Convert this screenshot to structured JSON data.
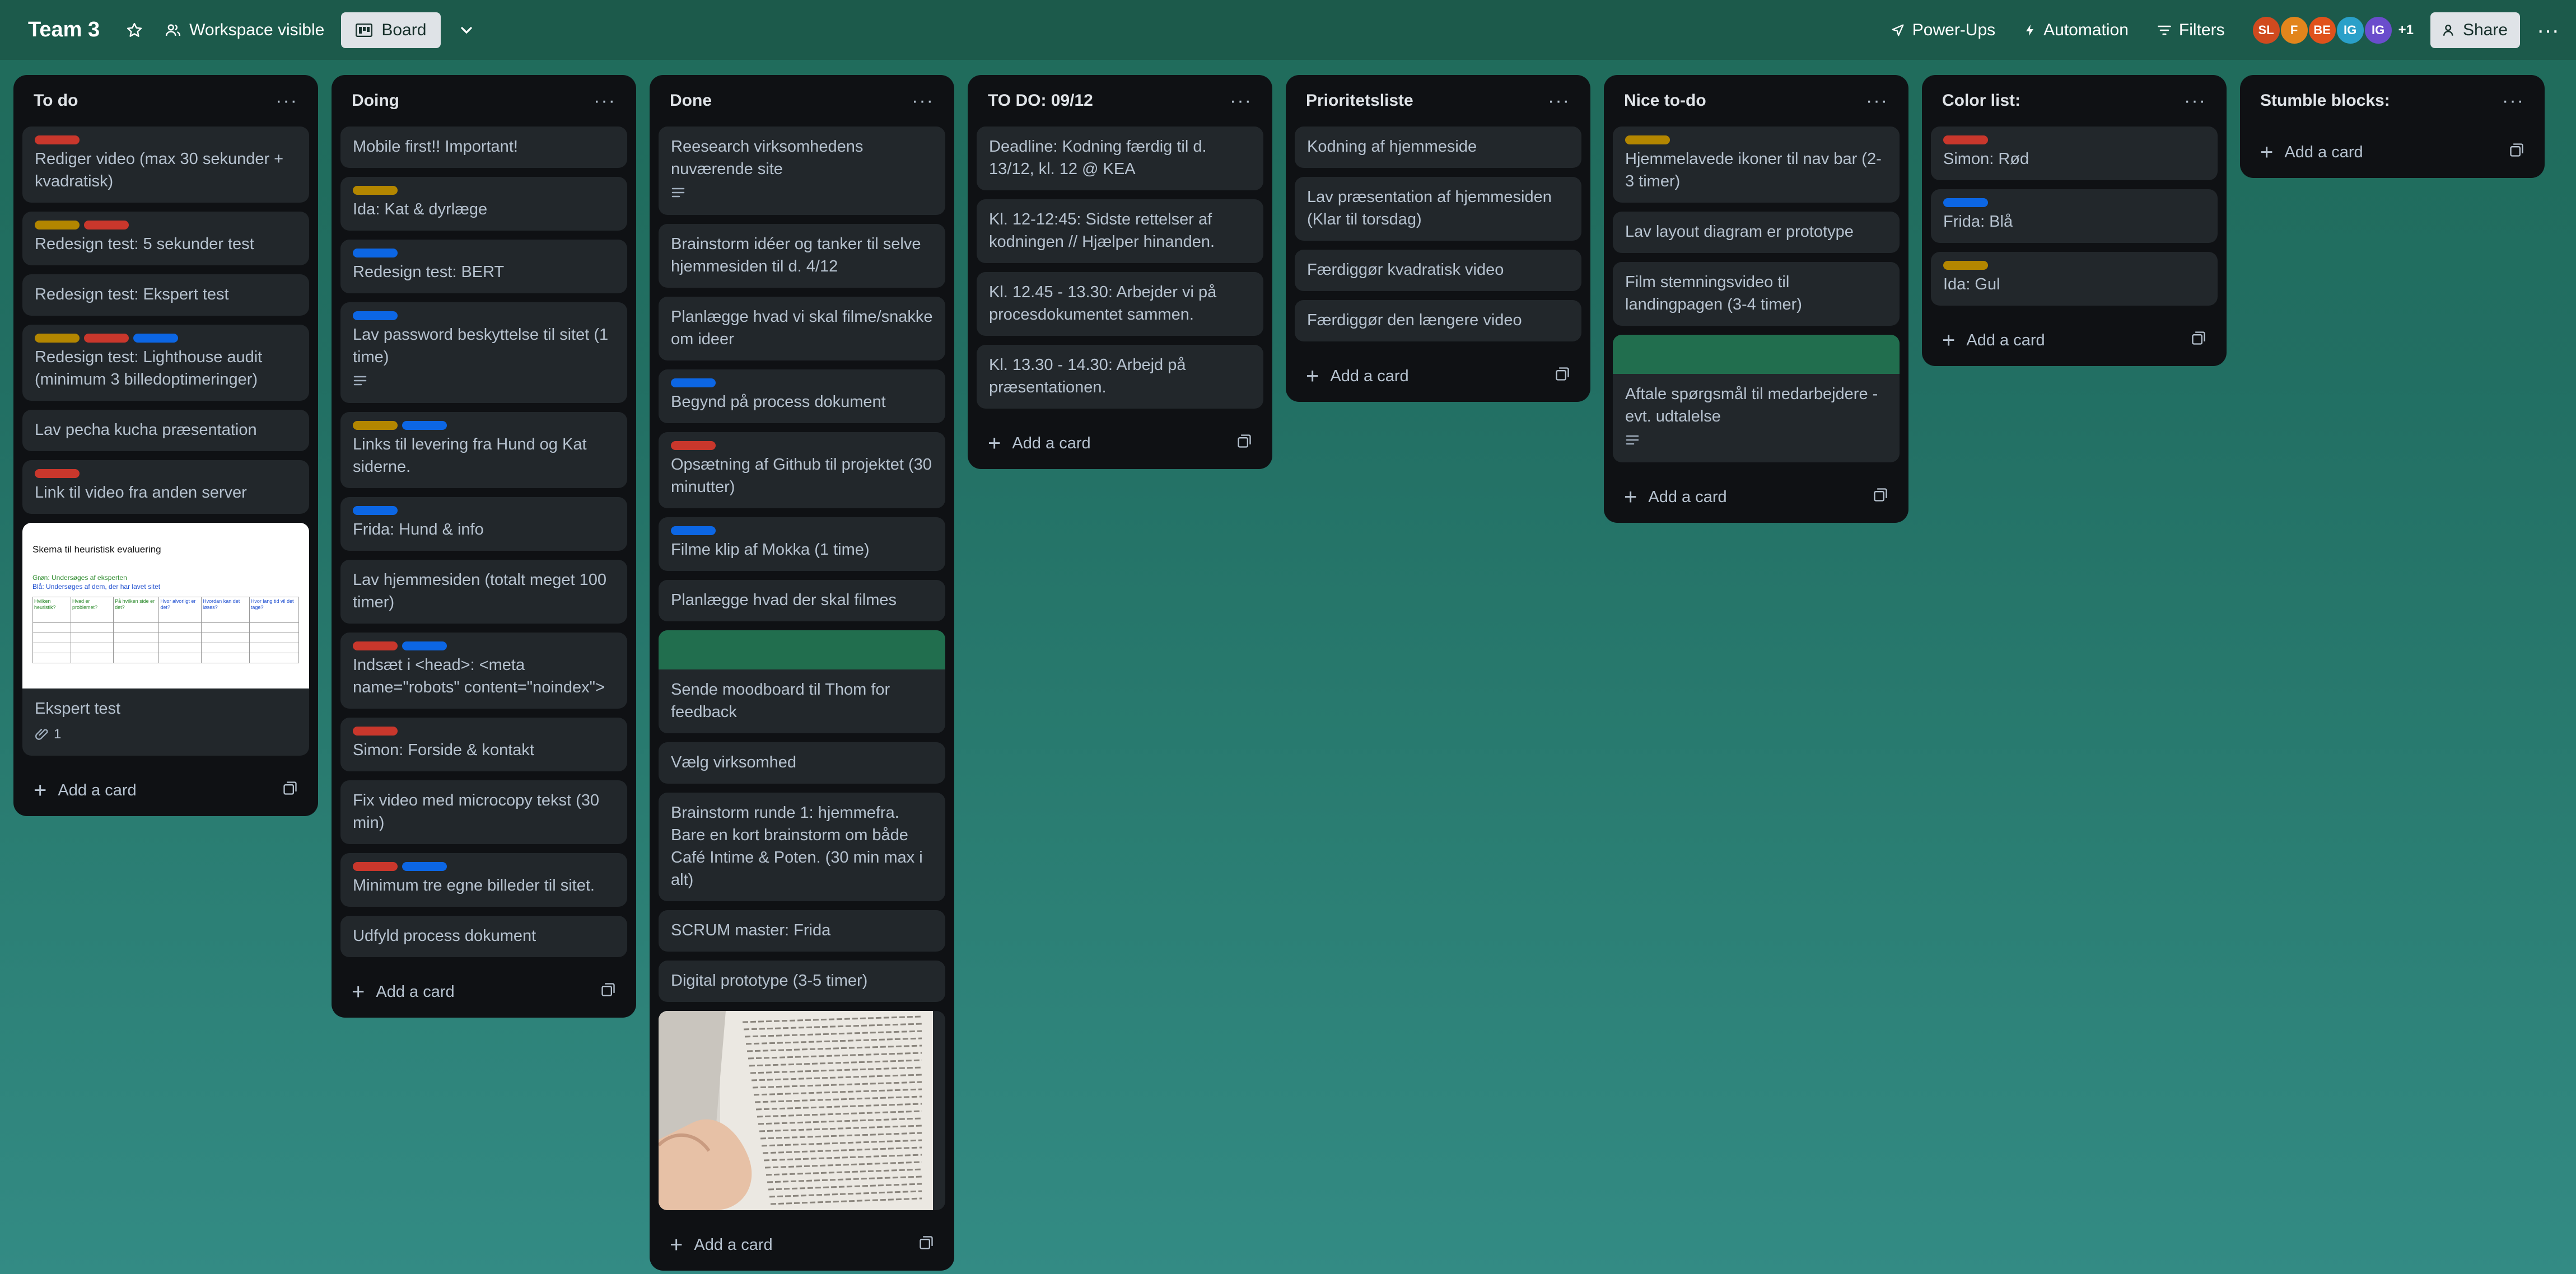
{
  "board": {
    "title": "Team 3",
    "visibility": "Workspace visible",
    "view": "Board"
  },
  "toolbar": {
    "powerups": "Power-Ups",
    "automation": "Automation",
    "filters": "Filters",
    "share": "Share",
    "more_members": "+1"
  },
  "members": [
    {
      "initials": "SL",
      "color": "#d04a1f"
    },
    {
      "initials": "F",
      "color": "#e2851c"
    },
    {
      "initials": "BE",
      "color": "#e0521c"
    },
    {
      "initials": "IG",
      "color": "#2aa0c9"
    },
    {
      "initials": "IG",
      "color": "#6a4dcc"
    }
  ],
  "add_card": "Add a card",
  "lists": [
    {
      "title": "To do",
      "cards": [
        {
          "text": "Rediger video (max 30 sekunder + kvadratisk)",
          "labels": [
            "red"
          ]
        },
        {
          "text": "Redesign test: 5 sekunder test",
          "labels": [
            "yellow",
            "red"
          ]
        },
        {
          "text": "Redesign test: Ekspert test",
          "labels": []
        },
        {
          "text": "Redesign test: Lighthouse audit (minimum 3 billedoptimeringer)",
          "labels": [
            "yellow",
            "red",
            "blue"
          ]
        },
        {
          "text": "Lav pecha kucha præsentation",
          "labels": []
        },
        {
          "text": "Link til video fra anden server",
          "labels": [
            "red"
          ]
        },
        {
          "text": "Ekspert test",
          "labels": [],
          "attachment": "1",
          "cover": "sheet",
          "sheet": {
            "title": "Skema til heuristisk evaluering",
            "line1": "Grøn: Undersøges af eksperten",
            "line2": "Blå: Undersøges af dem, der har lavet sitet",
            "cols": [
              "Hvilken heuristik?",
              "Hvad er problemet?",
              "På hvilken side er det?",
              "Hvor alvorligt er det?",
              "Hvordan kan det løses?",
              "Hvor lang tid vil det tage?"
            ]
          }
        }
      ]
    },
    {
      "title": "Doing",
      "cards": [
        {
          "text": "Mobile first!! Important!",
          "labels": []
        },
        {
          "text": "Ida: Kat & dyrlæge",
          "labels": [
            "yellow"
          ]
        },
        {
          "text": "Redesign test: BERT",
          "labels": [
            "blue"
          ]
        },
        {
          "text": "Lav password beskyttelse til sitet (1 time)",
          "labels": [
            "blue"
          ],
          "desc": true
        },
        {
          "text": "Links til levering fra Hund og Kat siderne.",
          "labels": [
            "yellow",
            "blue"
          ]
        },
        {
          "text": "Frida: Hund & info",
          "labels": [
            "blue"
          ]
        },
        {
          "text": "Lav hjemmesiden (totalt meget 100 timer)",
          "labels": []
        },
        {
          "text": "Indsæt i <head>: <meta name=\"robots\" content=\"noindex\">",
          "labels": [
            "red",
            "blue"
          ]
        },
        {
          "text": "Simon: Forside & kontakt",
          "labels": [
            "red"
          ]
        },
        {
          "text": "Fix video med microcopy tekst (30 min)",
          "labels": []
        },
        {
          "text": "Minimum tre egne billeder til sitet.",
          "labels": [
            "red",
            "blue"
          ]
        },
        {
          "text": "Udfyld process dokument",
          "labels": []
        }
      ]
    },
    {
      "title": "Done",
      "cards": [
        {
          "text": "Reesearch virksomhedens nuværende site",
          "labels": [],
          "desc": true
        },
        {
          "text": "Brainstorm idéer og tanker til selve hjemmesiden til d. 4/12",
          "labels": []
        },
        {
          "text": "Planlægge hvad vi skal filme/snakke om ideer",
          "labels": []
        },
        {
          "text": "Begynd på process dokument",
          "labels": [
            "blue"
          ]
        },
        {
          "text": "Opsætning af Github til projektet (30 minutter)",
          "labels": [
            "red"
          ]
        },
        {
          "text": "Filme klip af Mokka (1 time)",
          "labels": [
            "blue"
          ]
        },
        {
          "text": "Planlægge hvad der skal filmes",
          "labels": []
        },
        {
          "text": "Sende moodboard til Thom for feedback",
          "labels": [],
          "cover": "green"
        },
        {
          "text": "Vælg virksomhed",
          "labels": []
        },
        {
          "text": "Brainstorm runde 1: hjemmefra. Bare en kort brainstorm om både Café Intime & Poten. (30 min max i alt)",
          "labels": []
        },
        {
          "text": "SCRUM master: Frida",
          "labels": []
        },
        {
          "text": "Digital prototype (3-5 timer)",
          "labels": []
        },
        {
          "text": "",
          "labels": [],
          "cover": "photo"
        }
      ]
    },
    {
      "title": "TO DO: 09/12",
      "cards": [
        {
          "text": "Deadline: Kodning færdig til d. 13/12, kl. 12 @ KEA",
          "labels": []
        },
        {
          "text": "Kl. 12-12:45: Sidste rettelser af kodningen // Hjælper hinanden.",
          "labels": []
        },
        {
          "text": "Kl. 12.45 - 13.30: Arbejder vi på procesdokumentet sammen.",
          "labels": []
        },
        {
          "text": "Kl. 13.30 - 14.30: Arbejd på præsentationen.",
          "labels": []
        }
      ]
    },
    {
      "title": "Prioritetsliste",
      "cards": [
        {
          "text": "Kodning af hjemmeside",
          "labels": []
        },
        {
          "text": "Lav præsentation af hjemmesiden (Klar til torsdag)",
          "labels": []
        },
        {
          "text": "Færdiggør kvadratisk video",
          "labels": []
        },
        {
          "text": "Færdiggør den længere video",
          "labels": []
        }
      ]
    },
    {
      "title": "Nice to-do",
      "cards": [
        {
          "text": "Hjemmelavede ikoner til nav bar (2-3 timer)",
          "labels": [
            "yellow"
          ]
        },
        {
          "text": "Lav layout diagram er prototype",
          "labels": []
        },
        {
          "text": "Film stemningsvideo til landingpagen (3-4 timer)",
          "labels": []
        },
        {
          "text": "Aftale spørgsmål til medarbejdere - evt. udtalelse",
          "labels": [],
          "cover": "green",
          "desc": true
        }
      ]
    },
    {
      "title": "Color list:",
      "cards": [
        {
          "text": "Simon: Rød",
          "labels": [
            "red"
          ]
        },
        {
          "text": "Frida: Blå",
          "labels": [
            "blue"
          ]
        },
        {
          "text": "Ida: Gul",
          "labels": [
            "yellow"
          ]
        }
      ]
    },
    {
      "title": "Stumble blocks:",
      "cards": []
    }
  ]
}
